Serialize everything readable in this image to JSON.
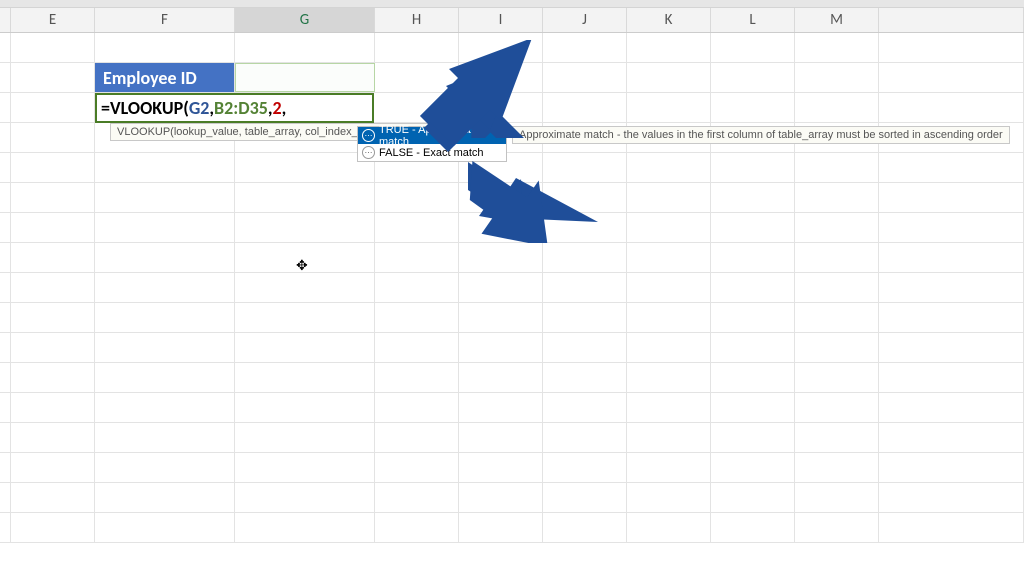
{
  "columns": [
    "E",
    "F",
    "G",
    "H",
    "I",
    "J",
    "K",
    "L",
    "M"
  ],
  "selected_column": "G",
  "labels": {
    "employee_id": "Employee ID"
  },
  "formula": {
    "prefix": "=VLOOKUP(",
    "a1": "G2",
    "comma1": ",",
    "a2": "B2:D35",
    "comma2": ",",
    "a3": "2",
    "comma3": ","
  },
  "hint": "VLOOKUP(lookup_value, table_array, col_index_num, [range_lookup])",
  "dropdown": {
    "items": [
      {
        "label": "TRUE - Approximate match",
        "selected": true
      },
      {
        "label": "FALSE - Exact match",
        "selected": false
      }
    ],
    "icon_glyph": "⋯"
  },
  "tooltip": "Approximate match - the values in the first column of table_array must be sorted in ascending order",
  "colors": {
    "accent_blue": "#4472c4",
    "formula_border": "#4a7c26",
    "arrow_blue": "#1f4e99"
  }
}
